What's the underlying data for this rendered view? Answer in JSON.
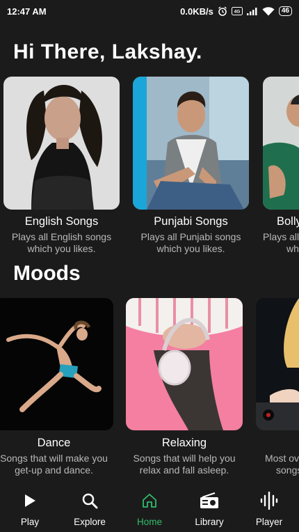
{
  "status": {
    "time": "12:47 AM",
    "speed": "0.0KB/s",
    "battery": "46"
  },
  "greeting": "Hi There, Lakshay.",
  "languages": [
    {
      "title": "English Songs",
      "desc_line1": "Plays all English songs",
      "desc_line2": "which you likes."
    },
    {
      "title": "Punjabi Songs",
      "desc_line1": "Plays all Punjabi songs",
      "desc_line2": "which you likes."
    },
    {
      "title": "Bolly",
      "desc_line1": "Plays all",
      "desc_line2": "wh"
    }
  ],
  "moods_title": "Moods",
  "moods": [
    {
      "title": "Dance",
      "desc_line1": "Songs that will make you",
      "desc_line2": "get-up and dance."
    },
    {
      "title": "Relaxing",
      "desc_line1": "Songs that will help you",
      "desc_line2": "relax and fall asleep."
    },
    {
      "title": "",
      "desc_line1": "Most ov",
      "desc_line2": "songs"
    }
  ],
  "nav": [
    {
      "label": "Play",
      "icon": "play-icon"
    },
    {
      "label": "Explore",
      "icon": "search-icon"
    },
    {
      "label": "Home",
      "icon": "home-icon",
      "active": true
    },
    {
      "label": "Library",
      "icon": "radio-icon"
    },
    {
      "label": "Player",
      "icon": "waveform-icon"
    }
  ],
  "colors": {
    "background": "#1c1b1b",
    "accent": "#2fbe6a",
    "secondary_text": "#b9b9b9"
  }
}
